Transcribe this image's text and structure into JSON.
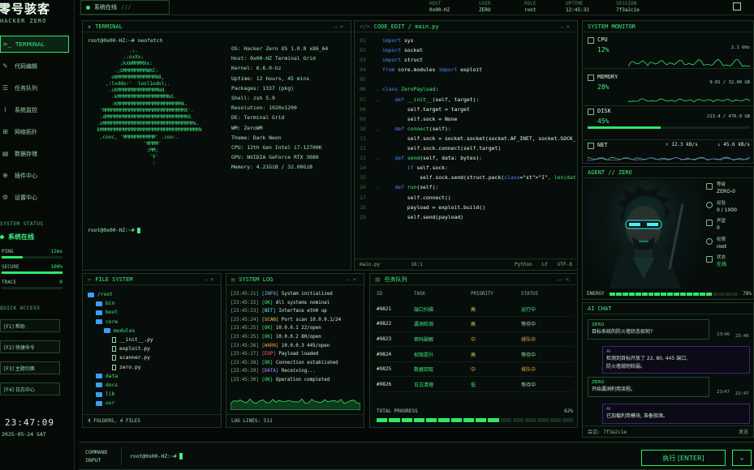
{
  "app": {
    "title": "零号骇客",
    "subtitle": "HACKER ZERO"
  },
  "nav": [
    {
      "label": "TERMINAL",
      "icon": "terminal-icon"
    },
    {
      "label": "代码编辑",
      "icon": "pencil-icon"
    },
    {
      "label": "任务队列",
      "icon": "list-icon"
    },
    {
      "label": "系统监控",
      "icon": "pulse-icon"
    },
    {
      "label": "网络拓扑",
      "icon": "network-icon"
    },
    {
      "label": "数据存储",
      "icon": "database-icon"
    },
    {
      "label": "插件中心",
      "icon": "plugin-icon"
    },
    {
      "label": "设置中心",
      "icon": "gear-icon"
    }
  ],
  "system_status": {
    "title": "SYSTEM STATUS",
    "state": "系统在线",
    "rows": [
      {
        "k": "PING",
        "v": "12ms",
        "pct": 0.35
      },
      {
        "k": "SECURE",
        "v": "100%",
        "pct": 1.0
      },
      {
        "k": "TRACE",
        "v": "0",
        "pct": 0.0
      }
    ]
  },
  "quick_access": {
    "title": "QUICK ACCESS",
    "items": [
      "[F1]  帮助",
      "[F2]  快捷命令",
      "[F3]  主题切换",
      "[F4]  日志中心"
    ]
  },
  "clock": {
    "time": "23:47:09",
    "date": "2025-05-24 SAT"
  },
  "topbar": {
    "status": "系统在线",
    "slashes": "///",
    "info": [
      {
        "k": "HOST",
        "v": "0x00-HZ"
      },
      {
        "k": "USER",
        "v": "ZERO"
      },
      {
        "k": "ROLE",
        "v": "root"
      },
      {
        "k": "UPTIME",
        "v": "12:45:33"
      },
      {
        "k": "SESSION",
        "v": "7f3a2c1e"
      }
    ]
  },
  "terminal": {
    "title": "TERMINAL",
    "prompt": "root@0x00-HZ:~# neofetch",
    "prompt2": "root@0x00-HZ:~#",
    "art": [
      "             .;.",
      "           .:oxXx;",
      "          ;kXWMMMMXx:",
      "        .;OMMMMMMMMWKC:",
      "       oNMMMMMMMMMMMMMN8,",
      "     ,:loddo:'  lool1odol;.",
      "      .cKMMMMMMMMMMMMMMWd.",
      "       .kMMMMMMMMMMMMMMMMMNd.",
      "       :KMMMMMMMMMMMMMMMMMMMMMMk.",
      "   'MMMMMMMMMMMMMMMMMMMMMMMMMMMMX'.",
      "   .dMMMMMMMMMMMMMMMMMMMMMMMMMMMMd.",
      "  .xMMMMMMMMMMMMMMMMMMMMMMMMMMMMMMMx.",
      "  kMMMMMMMMMMMMMMMMMMMMMMMMMMMMMMMMMMk",
      "   .cooc, 'MMMMMMMMMMM' .coo:.",
      "                  'MMMM'",
      "                   ;MM;",
      "                    'V'",
      "                     :"
    ],
    "info": [
      "OS: Hacker Zero OS 1.0.0 x86_64",
      "Host: 0x00-HZ Terminal Grid",
      "Kernel: 6.6.0-hz",
      "Uptime: 12 hours, 45 mins",
      "Packages: 1337 (pkg)",
      "Shell: zsh 5.9",
      "Resolution: 1920x1200",
      "DE: Terminal Grid",
      "WM: ZeroWM",
      "Theme: Dark Neon",
      "CPU: 12th Gen Intel i7-12700K",
      "GPU: NVIDIA GeForce RTX 3080",
      "Memory: 4.21GiB / 32.00GiB"
    ]
  },
  "editor": {
    "title": "CODE_EDIT / main.py",
    "lines": [
      {
        "n": "01",
        "t": "import sys"
      },
      {
        "n": "02",
        "t": "import socket"
      },
      {
        "n": "03",
        "t": "import struct"
      },
      {
        "n": "04",
        "t": "from core.modules import exploit"
      },
      {
        "n": "05",
        "t": ""
      },
      {
        "n": "06",
        "t": "class ZeroPayload:"
      },
      {
        "n": "07",
        "t": "    def __init__(self, target):"
      },
      {
        "n": "08",
        "t": "        self.target = target"
      },
      {
        "n": "09",
        "t": "        self.sock = None"
      },
      {
        "n": "10",
        "t": "    def connect(self):"
      },
      {
        "n": "11",
        "t": "        self.sock = socket.socket(socket.AF_INET, socket.SOCK_STREAM)"
      },
      {
        "n": "12",
        "t": "        self.sock.connect(self.target)"
      },
      {
        "n": "13",
        "t": "    def send(self, data: bytes):"
      },
      {
        "n": "14",
        "t": "        if self.sock:"
      },
      {
        "n": "15",
        "t": "            self.sock.send(struct.pack(\"I\", len(data)) + data)"
      },
      {
        "n": "16",
        "t": "    def run(self):"
      },
      {
        "n": "17",
        "t": "        self.connect()"
      },
      {
        "n": "18",
        "t": "        payload = exploit.build()"
      },
      {
        "n": "19",
        "t": "        self.send(payload)"
      }
    ],
    "status": {
      "file": "main.py",
      "pos": "16:1",
      "lang": "Python",
      "eol": "LF",
      "enc": "UTF-8"
    }
  },
  "monitor": {
    "title": "SYSTEM MONITOR",
    "cpu": {
      "label": "CPU",
      "pct": "12%",
      "val": "2.1 GHz"
    },
    "mem": {
      "label": "MEMORY",
      "pct": "28%",
      "val": "9.01 / 32.00 GB"
    },
    "disk": {
      "label": "DISK",
      "pct": "45%",
      "val": "213.4 / 476.9 GB"
    },
    "net": {
      "label": "NET",
      "up": "↑ 12.3 kB/s",
      "down": "↓ 45.6 kB/s"
    }
  },
  "agent": {
    "title": "AGENT // ZERO",
    "stats": [
      {
        "k": "等级",
        "v": "ZERO-0"
      },
      {
        "k": "经验",
        "v": "0 / 1000"
      },
      {
        "k": "声望",
        "v": "0"
      },
      {
        "k": "权限",
        "v": "root"
      },
      {
        "k": "状态",
        "v": "在线"
      }
    ],
    "energy": {
      "label": "ENERGY",
      "value": "78%",
      "pct": 0.78
    }
  },
  "chat": {
    "title": "AI CHAT",
    "msgs": [
      {
        "who": "ZERO",
        "text": "目标系统的防火墙状态如何?",
        "time": "23:46"
      },
      {
        "who": "AI",
        "text": "检测到目标开放了 22, 80, 445 端口,\n防火墙规则较弱。",
        "time": "23:46"
      },
      {
        "who": "ZERO",
        "text": "开始漏洞利用流程。",
        "time": "23:47"
      },
      {
        "who": "AI",
        "text": "已加载利用模块, 准备就绪。",
        "time": "23:47"
      }
    ],
    "footer": "会话: 7f3a2c1e",
    "send": "发送"
  },
  "files": {
    "title": "FILE SYSTEM",
    "tree": [
      {
        "d": 0,
        "n": "/root",
        "dir": true
      },
      {
        "d": 1,
        "n": "bin",
        "dir": true
      },
      {
        "d": 1,
        "n": "boot",
        "dir": true
      },
      {
        "d": 1,
        "n": "core",
        "dir": true
      },
      {
        "d": 2,
        "n": "modules",
        "dir": true
      },
      {
        "d": 3,
        "n": "__init__.py",
        "dir": false
      },
      {
        "d": 3,
        "n": "exploit.py",
        "dir": false
      },
      {
        "d": 3,
        "n": "scanner.py",
        "dir": false
      },
      {
        "d": 3,
        "n": "zero.py",
        "dir": false
      },
      {
        "d": 1,
        "n": "data",
        "dir": true
      },
      {
        "d": 1,
        "n": "docs",
        "dir": true
      },
      {
        "d": 1,
        "n": "lib",
        "dir": true
      },
      {
        "d": 1,
        "n": "usr",
        "dir": true
      }
    ],
    "footer": "4 FOLDERS, 4 FILES"
  },
  "log": {
    "title": "SYSTEM LOG",
    "lines": [
      {
        "t": "[23:45:21]",
        "tag": "[INFO]",
        "m": "System initialized"
      },
      {
        "t": "[23:45:22]",
        "tag": "[OK]",
        "m": "All systems nominal"
      },
      {
        "t": "[23:45:23]",
        "tag": "[NET]",
        "m": "Interface eth0 up"
      },
      {
        "t": "[23:45:24]",
        "tag": "[SCAN]",
        "m": "Port scan 10.0.0.1/24"
      },
      {
        "t": "[23:45:25]",
        "tag": "[OK]",
        "m": "10.0.0.1 22/open"
      },
      {
        "t": "[23:45:25]",
        "tag": "[OK]",
        "m": "10.0.0.2 80/open"
      },
      {
        "t": "[23:45:26]",
        "tag": "[WARN]",
        "m": "10.0.0.3 445/open"
      },
      {
        "t": "[23:45:27]",
        "tag": "[EXP]",
        "m": "Payload loaded"
      },
      {
        "t": "[23:45:28]",
        "tag": "[OK]",
        "m": "Connection established"
      },
      {
        "t": "[23:45:29]",
        "tag": "[DATA]",
        "m": "Receiving..."
      },
      {
        "t": "[23:45:30]",
        "tag": "[OK]",
        "m": "Operation completed"
      }
    ],
    "footer": "LOG LINES: 512"
  },
  "tasks": {
    "title": "任务队列",
    "headers": [
      "ID",
      "TASK",
      "PRIORITY",
      "STATUS"
    ],
    "rows": [
      {
        "id": "#9821",
        "task": "端口扫描",
        "pri": "高",
        "st": "运行中"
      },
      {
        "id": "#9822",
        "task": "漏洞检测",
        "pri": "高",
        "st": "等待中"
      },
      {
        "id": "#9823",
        "task": "密码破解",
        "pri": "中",
        "st": "排队中"
      },
      {
        "id": "#9824",
        "task": "权限提升",
        "pri": "高",
        "st": "等待中"
      },
      {
        "id": "#9825",
        "task": "数据窃取",
        "pri": "中",
        "st": "排队中"
      },
      {
        "id": "#9826",
        "task": "日志清理",
        "pri": "低",
        "st": "等待中"
      }
    ],
    "progress": {
      "label": "TOTAL PROGRESS",
      "value": "62%",
      "pct": 0.62
    }
  },
  "command": {
    "label1": "COMMAND",
    "label2": "INPUT",
    "prompt": "root@0x00-HZ:~#",
    "exec": "执行 [ENTER]"
  }
}
